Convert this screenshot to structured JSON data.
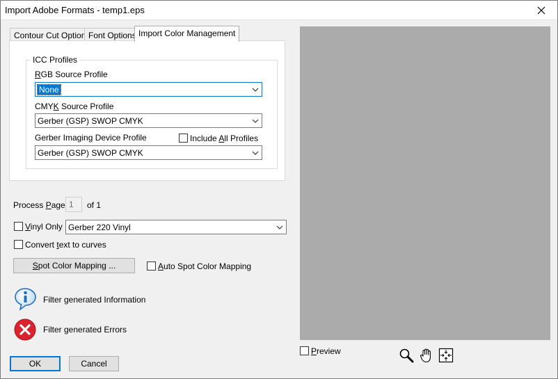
{
  "window": {
    "title": "Import Adobe Formats - temp1.eps"
  },
  "tabs": [
    {
      "label": "Contour Cut Options",
      "active": false
    },
    {
      "label": "Font Options",
      "active": false
    },
    {
      "label": "Import Color Management",
      "active": true
    }
  ],
  "icc": {
    "group_label": "ICC Profiles",
    "rgb_label_pre": "",
    "rgb_label_u": "R",
    "rgb_label_post": "GB Source Profile",
    "rgb_value": "None",
    "cmyk_label_pre": "CMY",
    "cmyk_label_u": "K",
    "cmyk_label_post": " Source Profile",
    "cmyk_value": "Gerber (GSP) SWOP CMYK",
    "device_label": "Gerber Imaging Device Profile",
    "include_all_pre": "Include ",
    "include_all_u": "A",
    "include_all_post": "ll Profiles",
    "include_all_checked": false,
    "device_value": "Gerber (GSP) SWOP CMYK"
  },
  "process": {
    "label_pre": "Process ",
    "label_u": "P",
    "label_post": "age",
    "page_value": "1",
    "of_text": "of 1"
  },
  "vinyl": {
    "label_pre": "",
    "label_u": "V",
    "label_post": "inyl Only",
    "checked": false,
    "value": "Gerber 220 Vinyl"
  },
  "convert": {
    "label_pre": "Convert ",
    "label_u": "t",
    "label_post": "ext to curves",
    "checked": false
  },
  "spot": {
    "button_pre": "",
    "button_u": "S",
    "button_post": "pot Color Mapping ...",
    "auto_pre": "",
    "auto_u": "A",
    "auto_post": "uto Spot Color Mapping",
    "auto_checked": false
  },
  "messages": {
    "info": "Filter generated Information",
    "error": "Filter generated Errors"
  },
  "buttons": {
    "ok": "OK",
    "cancel": "Cancel"
  },
  "preview": {
    "label_pre": "",
    "label_u": "P",
    "label_post": "review",
    "checked": false,
    "tools": [
      "magnifier-icon",
      "hand-pan-icon",
      "fit-to-window-icon"
    ]
  },
  "colors": {
    "accent": "#0078d7",
    "preview_bg": "#ababab",
    "error_red": "#d9232e",
    "info_blue": "#1f6fc5"
  }
}
